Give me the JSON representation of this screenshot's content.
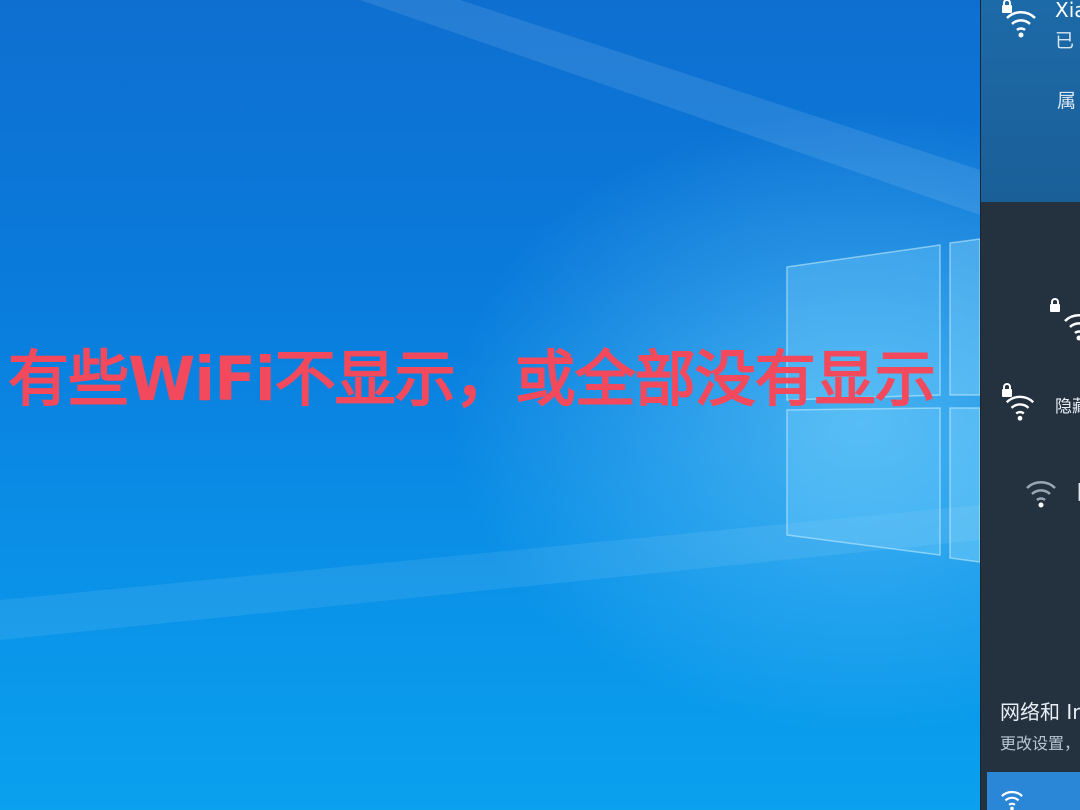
{
  "overlay": {
    "caption": "有些WiFi不显示，或全部没有显示"
  },
  "flyout": {
    "connected": {
      "name": "Xia",
      "status": "已",
      "properties": "属"
    },
    "networks": [
      {
        "label": ""
      },
      {
        "label": "隐藏"
      },
      {
        "label": "隐"
      }
    ],
    "settings": {
      "title": "网络和 In",
      "subtitle": "更改设置，"
    }
  },
  "colors": {
    "caption": "#f24a5c",
    "desktop_blue": "#0a7bdb",
    "flyout_bg": "#243240",
    "connected_bg": "#1d6aa8",
    "tile_accent": "#2a86d6"
  },
  "icons": [
    "wifi-icon",
    "lock-icon",
    "windows-logo"
  ]
}
